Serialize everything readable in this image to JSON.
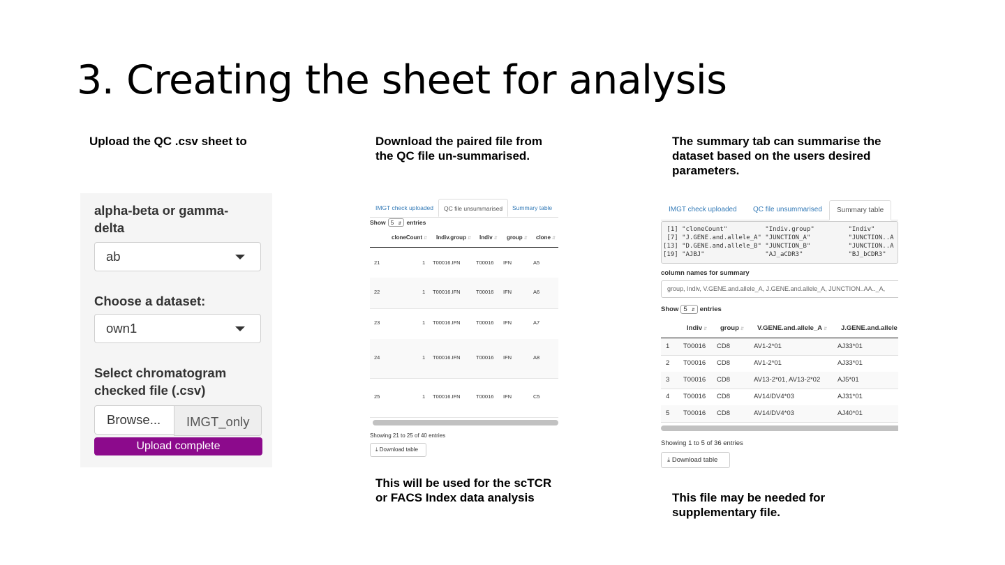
{
  "slide": {
    "title": "3. Creating the sheet for analysis",
    "captions": {
      "col1_top": "Upload the QC .csv sheet to",
      "col2_top_1": "Download the paired file from",
      "col2_top_2": "the QC file un-summarised.",
      "col2_bottom_1": "This will be used for the scTCR",
      "col2_bottom_2": "or FACS Index data analysis",
      "col3_top_1": "The summary tab can summarise the",
      "col3_top_2": "dataset based on the users desired",
      "col3_top_3": "parameters.",
      "col3_bottom_1": "This file may be needed for",
      "col3_bottom_2": "supplementary file."
    }
  },
  "upload_panel": {
    "chain_label_1": "alpha-beta or gamma-",
    "chain_label_2": "delta",
    "chain_value": "ab",
    "dataset_label": "Choose a dataset:",
    "dataset_value": "own1",
    "file_label_1": "Select chromatogram",
    "file_label_2": "checked file (.csv)",
    "browse_label": "Browse...",
    "file_name": "IMGT_only",
    "progress_text": "Upload complete",
    "accent_color": "#8c0a8c"
  },
  "qc_panel": {
    "tabs": [
      "IMGT check uploaded",
      "QC file unsummarised",
      "Summary table"
    ],
    "active_tab": "QC file unsummarised",
    "show_label": "Show",
    "entries_value": "5",
    "entries_label": "entries",
    "headers": [
      "cloneCount",
      "Indiv.group",
      "Indiv",
      "group",
      "clone"
    ],
    "rows": [
      [
        "21",
        "1",
        "T00016.IFN",
        "T00016",
        "IFN",
        "A5"
      ],
      [
        "22",
        "1",
        "T00016.IFN",
        "T00016",
        "IFN",
        "A6"
      ],
      [
        "23",
        "1",
        "T00016.IFN",
        "T00016",
        "IFN",
        "A7"
      ],
      [
        "24",
        "1",
        "T00016.IFN",
        "T00016",
        "IFN",
        "A8"
      ],
      [
        "25",
        "1",
        "T00016.IFN",
        "T00016",
        "IFN",
        "C5"
      ]
    ],
    "info": "Showing 21 to 25 of 40 entries",
    "download_label": "Download table"
  },
  "summary_panel": {
    "tabs": [
      "IMGT check uploaded",
      "QC file unsummarised",
      "Summary table"
    ],
    "active_tab": "Summary table",
    "console_lines": [
      " [1] \"cloneCount\"          \"Indiv.group\"         \"Indiv\"",
      " [7] \"J.GENE.and.allele_A\" \"JUNCTION_A\"          \"JUNCTION..A",
      "[13] \"D.GENE.and.allele_B\" \"JUNCTION_B\"          \"JUNCTION..A",
      "[19] \"AJBJ\"                \"AJ_aCDR3\"            \"BJ_bCDR3\""
    ],
    "columns_label": "column names for summary",
    "columns_value": "group, Indiv, V.GENE.and.allele_A, J.GENE.and.allele_A, JUNCTION..AA.._A,",
    "show_label": "Show",
    "entries_value": "5",
    "entries_label": "entries",
    "headers": [
      "Indiv",
      "group",
      "V.GENE.and.allele_A",
      "J.GENE.and.allele"
    ],
    "rows": [
      [
        "1",
        "T00016",
        "CD8",
        "AV1-2*01",
        "AJ33*01"
      ],
      [
        "2",
        "T00016",
        "CD8",
        "AV1-2*01",
        "AJ33*01"
      ],
      [
        "3",
        "T00016",
        "CD8",
        "AV13-2*01, AV13-2*02",
        "AJ5*01"
      ],
      [
        "4",
        "T00016",
        "CD8",
        "AV14/DV4*03",
        "AJ31*01"
      ],
      [
        "5",
        "T00016",
        "CD8",
        "AV14/DV4*03",
        "AJ40*01"
      ]
    ],
    "info": "Showing 1 to 5 of 36 entries",
    "download_label": "Download table"
  }
}
